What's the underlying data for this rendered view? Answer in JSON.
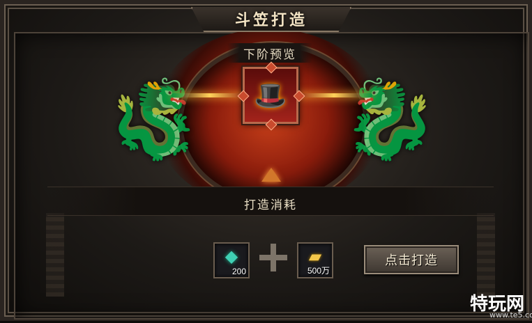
{
  "window": {
    "title": "斗笠打造"
  },
  "preview": {
    "label": "下阶预览",
    "icon": "golden-hat-icon"
  },
  "cost": {
    "label": "打造消耗",
    "items": [
      {
        "icon": "jade-gem-icon",
        "quantity": "200"
      },
      {
        "icon": "gold-ingot-icon",
        "quantity": "500万"
      }
    ]
  },
  "actions": {
    "craft_label": "点击打造"
  },
  "watermark": {
    "brand": "特玩网",
    "site": "www.te5.com"
  },
  "colors": {
    "title_text": "#f3e4c4",
    "slot_border": "#b86a4c",
    "glow": "#c8401a",
    "beam": "#ffd35a"
  }
}
